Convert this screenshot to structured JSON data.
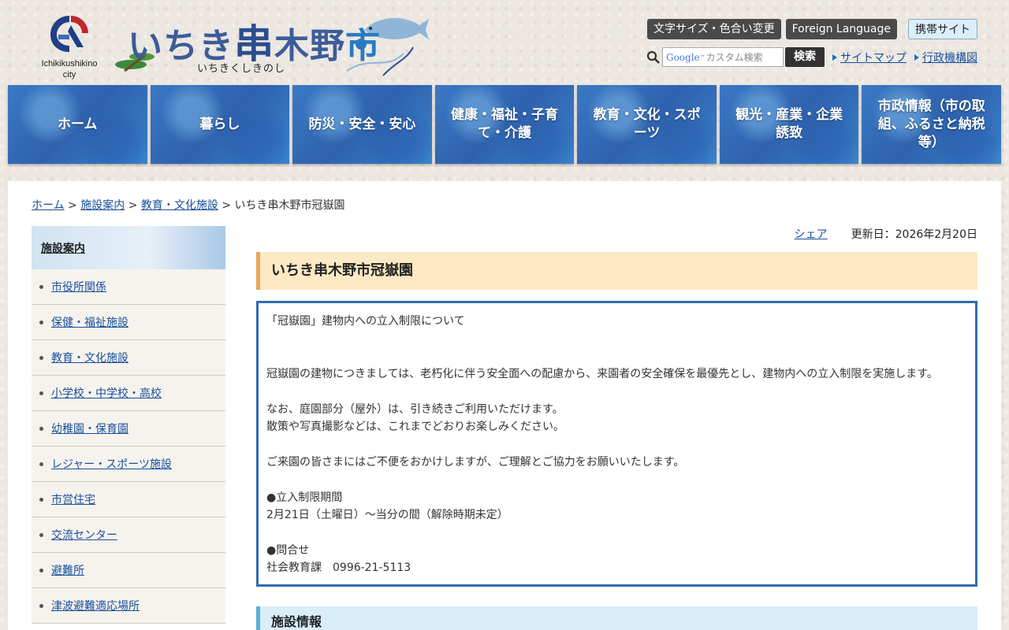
{
  "header": {
    "emblem_caption": "Ichikikushikino city",
    "site_title_1": "いちき",
    "site_title_2": "串",
    "site_title_3": "木野",
    "site_title_4": "市",
    "site_title_kana": "いちきくしきのし",
    "util_buttons": {
      "text_size": "文字サイズ・色合い変更",
      "foreign": "Foreign Language",
      "mobile": "携帯サイト"
    },
    "search": {
      "google": "Google",
      "placeholder": "カスタム検索",
      "button": "検索"
    },
    "links": {
      "sitemap": "サイトマップ",
      "org_chart": "行政機構図"
    }
  },
  "nav": [
    {
      "label": "ホーム"
    },
    {
      "label": "暮らし"
    },
    {
      "label": "防災・安全・安心"
    },
    {
      "label": "健康・福祉・子育て・介護"
    },
    {
      "label": "教育・文化・スポーツ"
    },
    {
      "label": "観光・産業・企業誘致"
    },
    {
      "label": "市政情報（市の取組、ふるさと納税等）"
    }
  ],
  "breadcrumb": {
    "home": "ホーム",
    "sep": " > ",
    "facilities": "施設案内",
    "education": "教育・文化施設",
    "current": "いちき串木野市冠嶽園"
  },
  "sidebar": {
    "heading": "施設案内",
    "items": [
      {
        "label": "市役所関係"
      },
      {
        "label": "保健・福祉施設"
      },
      {
        "label": "教育・文化施設"
      },
      {
        "label": "小学校・中学校・高校"
      },
      {
        "label": "幼稚園・保育園"
      },
      {
        "label": "レジャー・スポーツ施設"
      },
      {
        "label": "市営住宅"
      },
      {
        "label": "交流センター"
      },
      {
        "label": "避難所"
      },
      {
        "label": "津波避難適応場所"
      }
    ]
  },
  "content": {
    "share": "シェア",
    "updated": "更新日：2026年2月20日",
    "title": "いちき串木野市冠嶽園",
    "notice": {
      "heading": "「冠嶽園」建物内への立入制限について",
      "p1": "冠嶽園の建物につきましては、老朽化に伴う安全面への配慮から、来園者の安全確保を最優先とし、建物内への立入制限を実施します。",
      "p2a": "なお、庭園部分（屋外）は、引き続きご利用いただけます。",
      "p2b": "散策や写真撮影などは、これまでどおりお楽しみください。",
      "p3": "ご来園の皆さまにはご不便をおかけしますが、ご理解とご協力をお願いいたします。",
      "period_label": "●立入制限期間",
      "period": "2月21日（土曜日）～当分の間（解除時期未定）",
      "contact_label": "●問合せ",
      "contact": "社会教育課　0996-21-5113"
    },
    "section_heading": "施設情報"
  }
}
